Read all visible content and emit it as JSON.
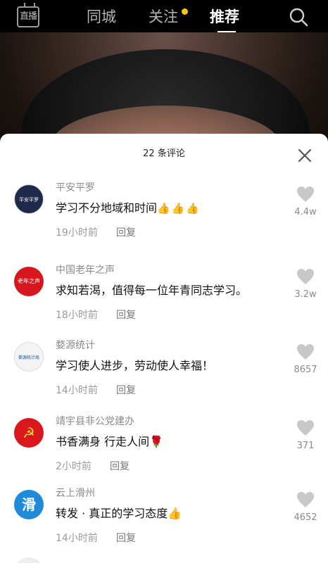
{
  "topbar": {
    "live_label": "直播",
    "tabs": [
      {
        "label": "同城"
      },
      {
        "label": "关注"
      },
      {
        "label": "推荐"
      }
    ]
  },
  "panel": {
    "title": "22 条评论"
  },
  "comments": [
    {
      "user": "平安平罗",
      "text": "学习不分地域和时间",
      "emoji": "👍👍👍",
      "time": "19小时前",
      "reply": "回复",
      "likes": "4.4w",
      "avatar_text": "平安平罗"
    },
    {
      "user": "中国老年之声",
      "text": "求知若渴，值得每一位年青同志学习。",
      "emoji": "",
      "time": "18小时前",
      "reply": "回复",
      "likes": "3.2w",
      "avatar_text": "老年之声"
    },
    {
      "user": "婺源统计",
      "text": "学习使人进步，劳动使人幸福！",
      "emoji": "",
      "time": "14小时前",
      "reply": "回复",
      "likes": "8657",
      "avatar_text": "婺源统计局"
    },
    {
      "user": "靖宇县非公党建办",
      "text": "书香满身 行走人间",
      "emoji": "🌹",
      "time": "2小时前",
      "reply": "回复",
      "likes": "371",
      "avatar_text": "☭"
    },
    {
      "user": "云上滑州",
      "text": "转发 · 真正的学习态度",
      "emoji": "👍",
      "time": "14小时前",
      "reply": "回复",
      "likes": "4652",
      "avatar_text": "滑"
    }
  ],
  "colors": {
    "accent_dot": "#f5c518",
    "panel_bg": "#ffffff"
  }
}
